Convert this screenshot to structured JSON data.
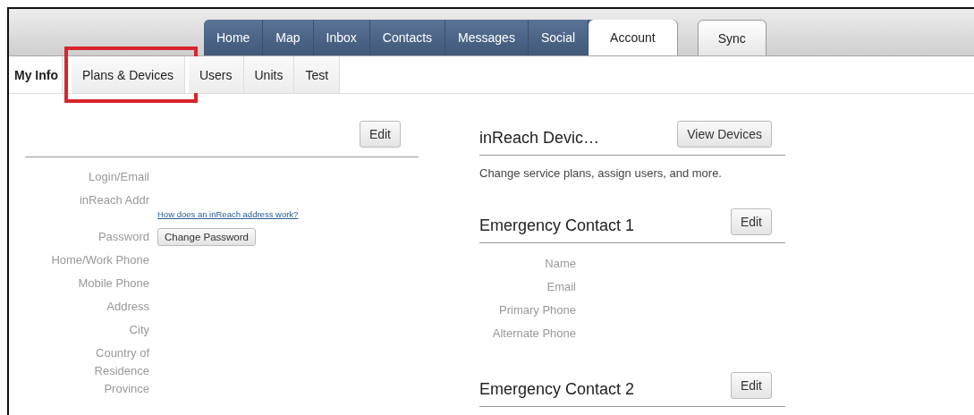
{
  "tabs": [
    {
      "label": "Home",
      "selected": false
    },
    {
      "label": "Map",
      "selected": false
    },
    {
      "label": "Inbox",
      "selected": false
    },
    {
      "label": "Contacts",
      "selected": false
    },
    {
      "label": "Messages",
      "selected": false
    },
    {
      "label": "Social",
      "selected": false
    },
    {
      "label": "Account",
      "selected": true
    }
  ],
  "sync_tab": {
    "label": "Sync"
  },
  "subtabs": [
    {
      "label": "My Info",
      "selected": true,
      "highlighted": false
    },
    {
      "label": "Plans & Devices",
      "selected": false,
      "highlighted": true
    },
    {
      "label": "Users",
      "selected": false,
      "highlighted": false
    },
    {
      "label": "Units",
      "selected": false,
      "highlighted": false
    },
    {
      "label": "Test",
      "selected": false,
      "highlighted": false
    }
  ],
  "profile": {
    "edit_button": "Edit",
    "fields": [
      {
        "label": "Login/Email"
      },
      {
        "label": "inReach Addr",
        "link": "How does an inReach address work?"
      },
      {
        "label": "Password",
        "button": "Change Password"
      },
      {
        "label": "Home/Work Phone"
      },
      {
        "label": "Mobile Phone"
      },
      {
        "label": "Address"
      },
      {
        "label": "City"
      },
      {
        "label": "Country of Residence"
      },
      {
        "label": "Province"
      }
    ]
  },
  "devices": {
    "title": "inReach Devic…",
    "button": "View Devices",
    "description": "Change service plans, assign users, and more."
  },
  "contacts": [
    {
      "title": "Emergency Contact 1",
      "edit_button": "Edit",
      "fields": [
        "Name",
        "Email",
        "Primary Phone",
        "Alternate Phone"
      ]
    },
    {
      "title": "Emergency Contact 2",
      "edit_button": "Edit"
    }
  ]
}
